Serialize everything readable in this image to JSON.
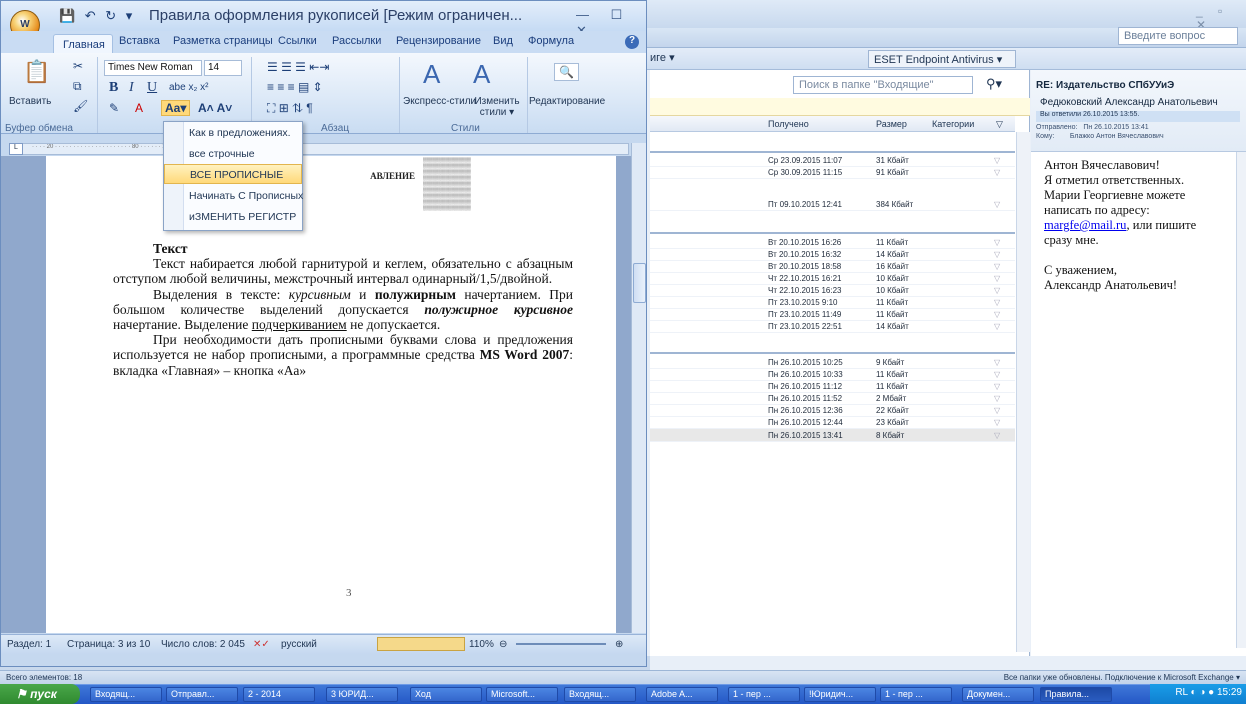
{
  "outlook": {
    "ask_placeholder": "Введите вопрос",
    "window_controls": "_ ▫ ✕",
    "eset_label": "ESET Endpoint Antivirus ▾",
    "misc_toolbar": "иге ▾",
    "search_placeholder": "Поиск в папке \"Входящие\"",
    "columns": {
      "received": "Получено",
      "size": "Размер",
      "categories": "Категории"
    },
    "rows": [
      {
        "date": "Ср 23.09.2015 11:07",
        "size": "31 Кбайт"
      },
      {
        "date": "Ср 30.09.2015 11:15",
        "size": "91 Кбайт"
      },
      {
        "date": "Пт 09.10.2015 12:41",
        "size": "384 Кбайт"
      },
      {
        "date": "Вт 20.10.2015 16:26",
        "size": "11 Кбайт"
      },
      {
        "date": "Вт 20.10.2015 16:32",
        "size": "14 Кбайт"
      },
      {
        "date": "Вт 20.10.2015 18:58",
        "size": "16 Кбайт"
      },
      {
        "date": "Чт 22.10.2015 16:21",
        "size": "10 Кбайт"
      },
      {
        "date": "Чт 22.10.2015 16:23",
        "size": "10 Кбайт"
      },
      {
        "date": "Пт 23.10.2015 9:10",
        "size": "11 Кбайт"
      },
      {
        "date": "Пт 23.10.2015 11:49",
        "size": "11 Кбайт"
      },
      {
        "date": "Пт 23.10.2015 22:51",
        "size": "14 Кбайт"
      },
      {
        "date": "Пн 26.10.2015 10:25",
        "size": "9 Кбайт"
      },
      {
        "date": "Пн 26.10.2015 10:33",
        "size": "11 Кбайт"
      },
      {
        "date": "Пн 26.10.2015 11:12",
        "size": "11 Кбайт"
      },
      {
        "date": "Пн 26.10.2015 11:52",
        "size": "2 Мбайт"
      },
      {
        "date": "Пн 26.10.2015 12:36",
        "size": "22 Кбайт"
      },
      {
        "date": "Пн 26.10.2015 12:44",
        "size": "23 Кбайт"
      },
      {
        "date": "Пн 26.10.2015 13:41",
        "size": "8 Кбайт"
      }
    ],
    "reading": {
      "subject": "RE: Издательство СПбУУиЭ",
      "from": "Федюковский Александр Анатольевич",
      "replied": "Вы ответили 26.10.2015 13:55.",
      "sent_label": "Отправлено:",
      "sent_value": "Пн 26.10.2015 13:41",
      "to_label": "Кому:",
      "to_value": "Блажко Антон Вячеславович",
      "greeting": "Антон Вячеславович!",
      "line1": "Я отметил ответственных.",
      "line2": "Марии Георгиевне можете написать по адресу:",
      "email": "margfe@mail.ru",
      "line3": ", или пишите сразу мне.",
      "regards": "С уважением,",
      "signature": "Александр Анатольевич!"
    },
    "status_left": "Всего элементов: 18",
    "status_right": "Все папки уже обновлены.  Подключение к Microsoft Exchange ▾"
  },
  "word": {
    "orb": "W",
    "qat": "💾 ↶ ↻ ▾",
    "title": "Правила оформления рукописей [Режим ограничен...",
    "controls": "— ☐ ✕",
    "tabs": [
      "Главная",
      "Вставка",
      "Разметка страницы",
      "Ссылки",
      "Рассылки",
      "Рецензирование",
      "Вид",
      "Формула"
    ],
    "font_name": "Times New Roman",
    "font_size": "14",
    "paste_label": "Вставить",
    "express_styles": "Экспресс-стили",
    "change_styles": "Изменить стили ▾",
    "editing": "Редактирование",
    "groups": [
      "Буфер обмена",
      "Абзац",
      "Стили"
    ],
    "case_menu": [
      {
        "label": "Как в предложениях."
      },
      {
        "label": "все строчные"
      },
      {
        "label": "ВСЕ ПРОПИСНЫЕ"
      },
      {
        "label": "Начинать С Прописных"
      },
      {
        "label": "иЗМЕНИТЬ РЕГИСТР"
      }
    ],
    "toc_title": "АВЛЕНИЕ",
    "doc": {
      "heading": "Текст",
      "p1": "Текст набирается любой гарнитурой и кеглем, обязательно с абзацным отступом любой величины, межстрочный интервал одинарный/1,5/двойной.",
      "p2a": "Выделения в тексте: ",
      "p2b": "курсивным",
      "p2c": " и ",
      "p2d": "полужирным",
      "p2e": " начертанием. При большом количестве выделений допускается ",
      "p2f": "полужирное курсивное",
      "p2g": " начертание. Выделение ",
      "p2h": "подчеркиванием",
      "p2i": " не допускается.",
      "p3a": "При необходимости дать прописными буквами слова и предложения используется не набор прописными, а программные средства ",
      "p3b": "MS Word 2007",
      "p3c": ": вкладка «Главная» – кнопка «Аа»"
    },
    "page_number": "3",
    "status": {
      "section": "Раздел: 1",
      "page": "Страница: 3 из 10",
      "words": "Число слов: 2 045",
      "lang": "русский",
      "zoom": "110%"
    }
  },
  "taskbar": {
    "start": "пуск",
    "buttons": [
      "Входящ...",
      "Отправл...",
      "2 - 2014",
      "3 ЮРИД...",
      "Ход",
      "Microsoft...",
      "Входящ...",
      "Adobe A...",
      "1 - пер ...",
      "!Юридич...",
      "1 - пер ...",
      "Докумен...",
      "Правила..."
    ],
    "clock": "15:29",
    "lang": "RL"
  }
}
